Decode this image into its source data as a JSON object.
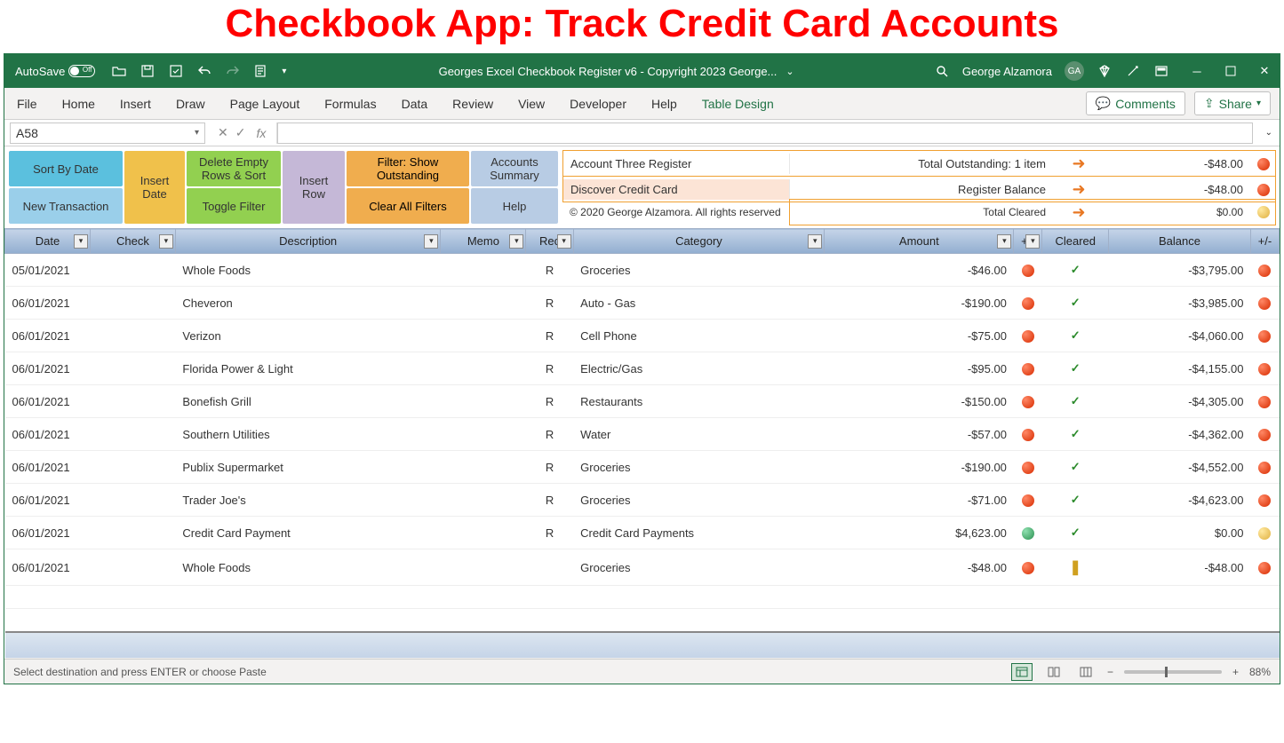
{
  "page_title": "Checkbook App: Track Credit Card Accounts",
  "titlebar": {
    "autosave_label": "AutoSave",
    "app_title": "Georges Excel Checkbook Register v6 - Copyright 2023 George...",
    "user_name": "George Alzamora",
    "user_initials": "GA"
  },
  "ribbon": {
    "tabs": [
      "File",
      "Home",
      "Insert",
      "Draw",
      "Page Layout",
      "Formulas",
      "Data",
      "Review",
      "View",
      "Developer",
      "Help",
      "Table Design"
    ],
    "active_tab": "Table Design",
    "comments": "Comments",
    "share": "Share"
  },
  "formula": {
    "name_box": "A58"
  },
  "actions": {
    "sort_by_date": "Sort By Date",
    "new_transaction": "New Transaction",
    "insert_date": "Insert Date",
    "delete_empty": "Delete Empty Rows & Sort",
    "toggle_filter": "Toggle Filter",
    "insert_row": "Insert Row",
    "filter_outstanding": "Filter: Show Outstanding",
    "clear_filters": "Clear All Filters",
    "accounts_summary": "Accounts Summary",
    "help": "Help"
  },
  "summary": {
    "row1_left": "Account Three Register",
    "row1_mid": "Total Outstanding: 1 item",
    "row1_val": "-$48.00",
    "row2_left": "Discover Credit Card",
    "row2_mid": "Register Balance",
    "row2_val": "-$48.00",
    "row3_mid": "Total Cleared",
    "row3_val": "$0.00",
    "copyright": "© 2020 George Alzamora. All rights reserved"
  },
  "headers": {
    "date": "Date",
    "check": "Check",
    "desc": "Description",
    "memo": "Memo",
    "rec": "Rec",
    "cat": "Category",
    "amt": "Amount",
    "pm1": "+/-",
    "clr": "Cleared",
    "bal": "Balance",
    "pm2": "+/-"
  },
  "rows": [
    {
      "date": "05/01/2021",
      "check": "",
      "desc": "Whole Foods",
      "memo": "",
      "rec": "R",
      "cat": "Groceries",
      "amt": "-$46.00",
      "pm1": "red",
      "clr": "check",
      "bal": "-$3,795.00",
      "pm2": "red"
    },
    {
      "date": "06/01/2021",
      "check": "",
      "desc": "Cheveron",
      "memo": "",
      "rec": "R",
      "cat": "Auto - Gas",
      "amt": "-$190.00",
      "pm1": "red",
      "clr": "check",
      "bal": "-$3,985.00",
      "pm2": "red"
    },
    {
      "date": "06/01/2021",
      "check": "",
      "desc": "Verizon",
      "memo": "",
      "rec": "R",
      "cat": "Cell Phone",
      "amt": "-$75.00",
      "pm1": "red",
      "clr": "check",
      "bal": "-$4,060.00",
      "pm2": "red"
    },
    {
      "date": "06/01/2021",
      "check": "",
      "desc": "Florida Power & Light",
      "memo": "",
      "rec": "R",
      "cat": "Electric/Gas",
      "amt": "-$95.00",
      "pm1": "red",
      "clr": "check",
      "bal": "-$4,155.00",
      "pm2": "red"
    },
    {
      "date": "06/01/2021",
      "check": "",
      "desc": "Bonefish Grill",
      "memo": "",
      "rec": "R",
      "cat": "Restaurants",
      "amt": "-$150.00",
      "pm1": "red",
      "clr": "check",
      "bal": "-$4,305.00",
      "pm2": "red"
    },
    {
      "date": "06/01/2021",
      "check": "",
      "desc": "Southern Utilities",
      "memo": "",
      "rec": "R",
      "cat": "Water",
      "amt": "-$57.00",
      "pm1": "red",
      "clr": "check",
      "bal": "-$4,362.00",
      "pm2": "red"
    },
    {
      "date": "06/01/2021",
      "check": "",
      "desc": "Publix Supermarket",
      "memo": "",
      "rec": "R",
      "cat": "Groceries",
      "amt": "-$190.00",
      "pm1": "red",
      "clr": "check",
      "bal": "-$4,552.00",
      "pm2": "red"
    },
    {
      "date": "06/01/2021",
      "check": "",
      "desc": "Trader Joe's",
      "memo": "",
      "rec": "R",
      "cat": "Groceries",
      "amt": "-$71.00",
      "pm1": "red",
      "clr": "check",
      "bal": "-$4,623.00",
      "pm2": "red"
    },
    {
      "date": "06/01/2021",
      "check": "",
      "desc": "Credit Card Payment",
      "memo": "",
      "rec": "R",
      "cat": "Credit Card Payments",
      "amt": "$4,623.00",
      "pm1": "green",
      "clr": "check",
      "bal": "$0.00",
      "pm2": "yellow"
    },
    {
      "date": "06/01/2021",
      "check": "",
      "desc": "Whole Foods",
      "memo": "",
      "rec": "",
      "cat": "Groceries",
      "amt": "-$48.00",
      "pm1": "red",
      "clr": "excl",
      "bal": "-$48.00",
      "pm2": "red"
    }
  ],
  "statusbar": {
    "msg": "Select destination and press ENTER or choose Paste",
    "zoom": "88%"
  }
}
